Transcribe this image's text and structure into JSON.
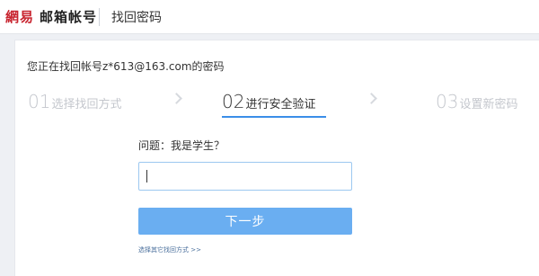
{
  "header": {
    "logo_mark": "網易",
    "logo_text": "邮箱帐号",
    "page_title": "找回密码"
  },
  "main": {
    "account_line": "您正在找回帐号z*613@163.com的密码",
    "steps": [
      {
        "num": "01",
        "label": "选择找回方式",
        "active": false
      },
      {
        "num": "02",
        "label": "进行安全验证",
        "active": true
      },
      {
        "num": "03",
        "label": "设置新密码",
        "active": false
      }
    ],
    "question": "问题：我是学生？",
    "answer": {
      "value": "",
      "placeholder": ""
    },
    "next_button": "下一步",
    "other_methods_link": "选择其它找回方式 >>"
  },
  "colors": {
    "brand_red": "#c8242f",
    "accent_blue": "#3b8ee8",
    "button_blue": "#6aaef1",
    "inactive_step": "#c4c7cd",
    "page_bg": "#eef0f4"
  },
  "icons": [
    "chevron-right-icon",
    "chevron-right-icon"
  ]
}
